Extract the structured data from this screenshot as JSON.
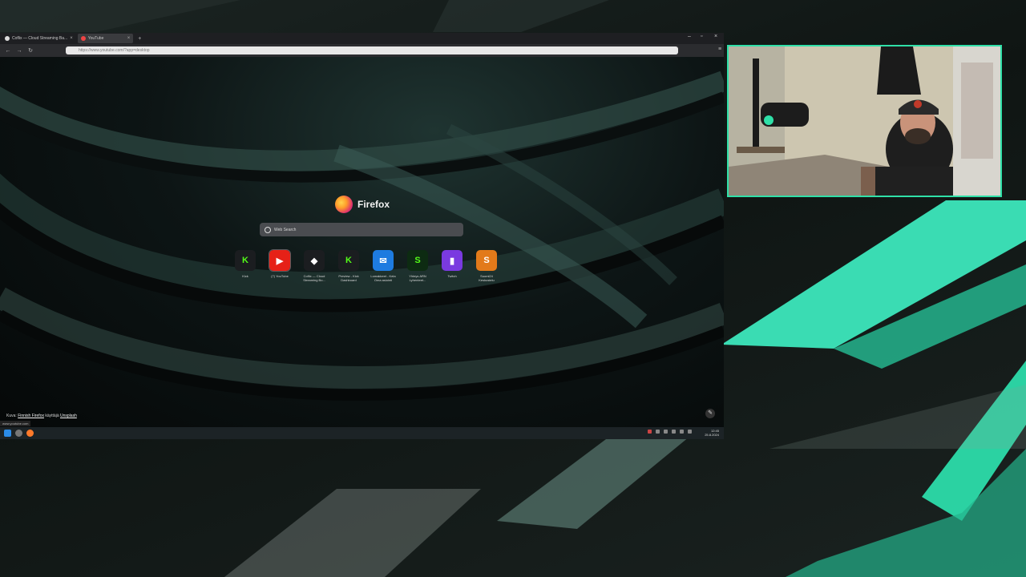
{
  "tabs": [
    {
      "label": "Coflix — Cloud Streaming Ba...",
      "active": false
    },
    {
      "label": "YouTube",
      "active": true
    }
  ],
  "url": "https://www.youtube.com/?app=desktop",
  "newtab": {
    "brand": "Firefox",
    "search_placeholder": "Web Search",
    "shortcuts": [
      {
        "label": "Kick",
        "glyph": "K",
        "color": "#53fc18",
        "bg": "#1b1d20"
      },
      {
        "label": "(7) YouTube",
        "glyph": "▶",
        "color": "#ffffff",
        "bg": "#e62117"
      },
      {
        "label": "Coflix — Cloud Streaming Bo...",
        "glyph": "◆",
        "color": "#ffffff",
        "bg": "#1b1d20"
      },
      {
        "label": "Preview - Kick Dashboard",
        "glyph": "K",
        "color": "#53fc18",
        "bg": "#1b1d20"
      },
      {
        "label": "Lomakkeet - Kela Oma asiointi",
        "glyph": "✉",
        "color": "#ffffff",
        "bg": "#1e7be0"
      },
      {
        "label": "Yhteys ARN Lyhenteet...",
        "glyph": "S",
        "color": "#53fc18",
        "bg": "#0d2b12"
      },
      {
        "label": "Twitch",
        "glyph": "▮",
        "color": "#ffffff",
        "bg": "#7a3ae0"
      },
      {
        "label": "Suomi24 Keskustelu",
        "glyph": "S",
        "color": "#ffffff",
        "bg": "#e27a1a"
      }
    ],
    "photo_credit_prefix": "Kuva:",
    "photo_credit_author": "Finnish Firefox",
    "photo_credit_mid": "käyttäjä",
    "photo_credit_site": "Unsplash",
    "status_url": "www.youtube.com"
  },
  "taskbar": {
    "time": "12:45",
    "date": "25.8.2024"
  },
  "colors": {
    "accent": "#2fe0a8",
    "bg_dark": "#141b19"
  }
}
